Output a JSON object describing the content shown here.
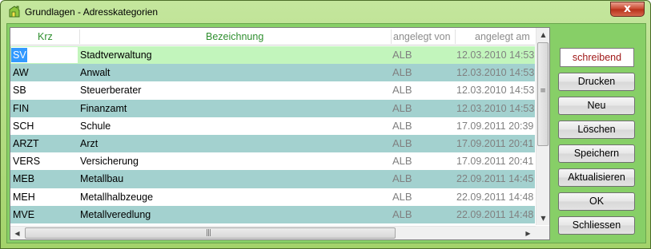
{
  "window": {
    "title": "Grundlagen - Adresskategorien",
    "close_label": "x"
  },
  "grid": {
    "columns": [
      "Krz",
      "Bezeichnung",
      "angelegt von",
      "angelegt am"
    ],
    "rows": [
      {
        "krz": "SV",
        "bezeichnung": "Stadtverwaltung",
        "angelegt_von": "ALB",
        "angelegt_am": "12.03.2010 14:53"
      },
      {
        "krz": "AW",
        "bezeichnung": "Anwalt",
        "angelegt_von": "ALB",
        "angelegt_am": "12.03.2010 14:53"
      },
      {
        "krz": "SB",
        "bezeichnung": "Steuerberater",
        "angelegt_von": "ALB",
        "angelegt_am": "12.03.2010 14:53"
      },
      {
        "krz": "FIN",
        "bezeichnung": "Finanzamt",
        "angelegt_von": "ALB",
        "angelegt_am": "12.03.2010 14:53"
      },
      {
        "krz": "SCH",
        "bezeichnung": "Schule",
        "angelegt_von": "ALB",
        "angelegt_am": "17.09.2011 20:39"
      },
      {
        "krz": "ARZT",
        "bezeichnung": "Arzt",
        "angelegt_von": "ALB",
        "angelegt_am": "17.09.2011 20:41"
      },
      {
        "krz": "VERS",
        "bezeichnung": "Versicherung",
        "angelegt_von": "ALB",
        "angelegt_am": "17.09.2011 20:41"
      },
      {
        "krz": "MEB",
        "bezeichnung": "Metallbau",
        "angelegt_von": "ALB",
        "angelegt_am": "22.09.2011 14:45"
      },
      {
        "krz": "MEH",
        "bezeichnung": "Metallhalbzeuge",
        "angelegt_von": "ALB",
        "angelegt_am": "22.09.2011 14:48"
      },
      {
        "krz": "MVE",
        "bezeichnung": "Metallveredlung",
        "angelegt_von": "ALB",
        "angelegt_am": "22.09.2011 14:48"
      }
    ]
  },
  "panel": {
    "status": "schreibend",
    "buttons": {
      "drucken": "Drucken",
      "neu": "Neu",
      "loeschen": "Löschen",
      "speichern": "Speichern",
      "aktualisieren": "Aktualisieren",
      "ok": "OK",
      "schliessen": "Schliessen"
    }
  },
  "colors": {
    "header_green": "#2f8f2f",
    "row_alt": "#a3d1cf",
    "row_selected": "#c2f5bc",
    "status_text": "#a01818",
    "client_bg": "#87cf67"
  }
}
